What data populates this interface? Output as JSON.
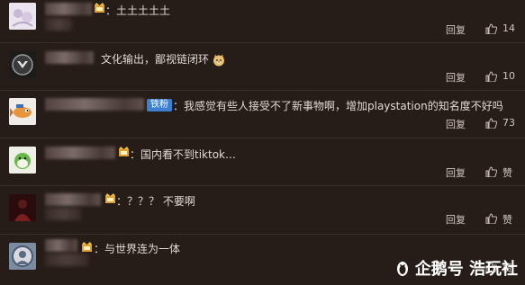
{
  "comments": [
    {
      "text": "：土土土土土",
      "reply": "回复",
      "likes": "14"
    },
    {
      "text": "文化输出，鄙视链闭环",
      "reply": "回复",
      "likes": "10"
    },
    {
      "badge": "铁粉",
      "text": "：我感觉有些人接受不了新事物啊，增加playstation的知名度不好吗",
      "reply": "回复",
      "likes": "73"
    },
    {
      "text": "：国内看不到tiktok…",
      "reply": "回复",
      "likes": "赞"
    },
    {
      "text": "：？？？ 不要啊",
      "reply": "回复",
      "likes": "赞"
    },
    {
      "text": "：与世界连为一体",
      "reply": "",
      "likes": "赞"
    }
  ],
  "watermark": {
    "text": "企鹅号 浩玩社"
  },
  "colors": {
    "background": "#261c18",
    "badge": "#3d7fd0",
    "crown": "#e0a030"
  },
  "icons": {
    "like": "thumbs-up-icon",
    "crown": "crown-icon",
    "watermark": "penguin-icon"
  }
}
